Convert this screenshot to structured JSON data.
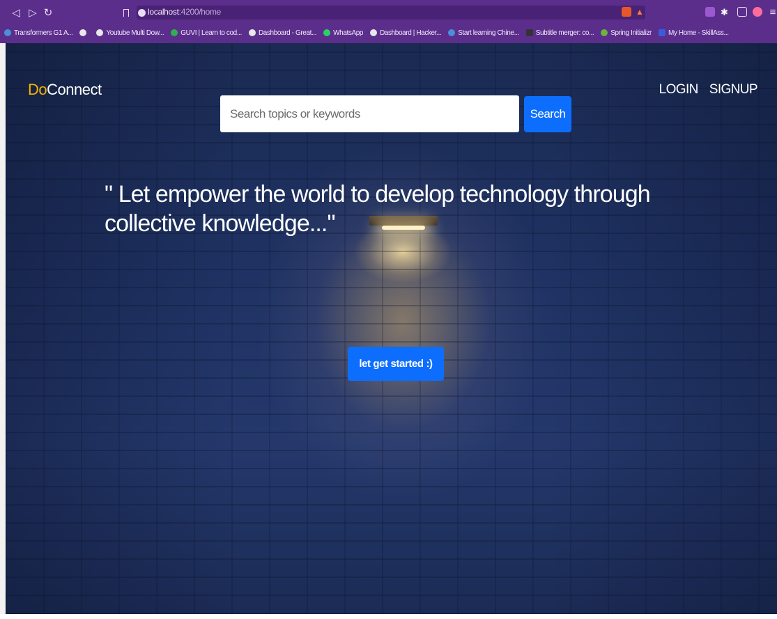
{
  "browser": {
    "url_host": "localhost",
    "url_path": ":4200/home",
    "bookmarks": [
      {
        "label": "Transformers G1 A...",
        "icon": "transformers-icon",
        "color": "#4a90d9"
      },
      {
        "label": "",
        "icon": "chrome-icon",
        "color": "#e8e8e8"
      },
      {
        "label": "Youtube Multi Dow...",
        "icon": "chrome-icon",
        "color": "#e8e8e8"
      },
      {
        "label": "GUVI | Learn to cod...",
        "icon": "guvi-icon",
        "color": "#2bb24c"
      },
      {
        "label": "Dashboard - Great...",
        "icon": "greatlearning-icon",
        "color": "#e8e8e8"
      },
      {
        "label": "WhatsApp",
        "icon": "whatsapp-icon",
        "color": "#25d366"
      },
      {
        "label": "Dashboard | Hacker...",
        "icon": "chrome-icon",
        "color": "#e8e8e8"
      },
      {
        "label": "Start learning Chine...",
        "icon": "chinese-icon",
        "color": "#4a90d9"
      },
      {
        "label": "Subtitle merger: co...",
        "icon": "subtitle-icon",
        "color": "#333333"
      },
      {
        "label": "Spring Initializr",
        "icon": "spring-icon",
        "color": "#6db33f"
      },
      {
        "label": "My Home - SkillAss...",
        "icon": "skillassure-icon",
        "color": "#3b5bdb"
      }
    ]
  },
  "site": {
    "brand_prefix": "Do",
    "brand_suffix": "Connect",
    "login_label": "LOGIN",
    "signup_label": "SIGNUP",
    "search_placeholder": "Search topics or keywords",
    "search_button": "Search",
    "tagline": "\" Let empower the world to develop technology through collective knowledge...\"",
    "cta_label": "let get started :)"
  },
  "colors": {
    "browser_chrome": "#5b2e8c",
    "brand_accent": "#f4b400",
    "primary_button": "#0d6efd"
  }
}
